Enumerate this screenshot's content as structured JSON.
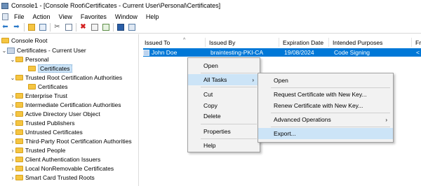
{
  "window": {
    "title": "Console1 - [Console Root\\Certificates - Current User\\Personal\\Certificates]"
  },
  "menubar": [
    "File",
    "Action",
    "View",
    "Favorites",
    "Window",
    "Help"
  ],
  "toolbar": [
    "back-icon",
    "forward-icon",
    "up-folder-icon",
    "show-hide-tree-icon",
    "cut-icon",
    "copy-icon",
    "delete-icon",
    "properties-icon",
    "export-list-icon",
    "help-icon",
    "view-icon"
  ],
  "tree": {
    "root": "Console Root",
    "certs_current_user": "Certificates - Current User",
    "personal": "Personal",
    "personal_certs": "Certificates",
    "trusted_root": "Trusted Root Certification Authorities",
    "trusted_root_certs": "Certificates",
    "enterprise_trust": "Enterprise Trust",
    "intermediate": "Intermediate Certification Authorities",
    "active_directory": "Active Directory User Object",
    "trusted_publishers": "Trusted Publishers",
    "untrusted": "Untrusted Certificates",
    "third_party": "Third-Party Root Certification Authorities",
    "trusted_people": "Trusted People",
    "client_auth": "Client Authentication Issuers",
    "local_nonremovable": "Local NonRemovable Certificates",
    "smart_card": "Smart Card Trusted Roots"
  },
  "list": {
    "columns": [
      "Issued To",
      "Issued By",
      "Expiration Date",
      "Intended Purposes",
      "Fr"
    ],
    "row": {
      "issued_to": "John Doe",
      "issued_by": "braintesting-PKI-CA",
      "expiration": "19/08/2024",
      "purposes": "Code Signing",
      "friendly": "<"
    }
  },
  "context_menu": {
    "open": "Open",
    "all_tasks": "All Tasks",
    "cut": "Cut",
    "copy": "Copy",
    "delete": "Delete",
    "properties": "Properties",
    "help": "Help"
  },
  "submenu": {
    "open": "Open",
    "request_new_key": "Request Certificate with New Key...",
    "renew_new_key": "Renew Certificate with New Key...",
    "advanced": "Advanced Operations",
    "export": "Export..."
  },
  "arrows": {
    "submenu": "›",
    "sort": "^"
  },
  "colors": {
    "selection": "#0078d7",
    "highlight": "#cce4f7",
    "folder": "#f5c542"
  }
}
